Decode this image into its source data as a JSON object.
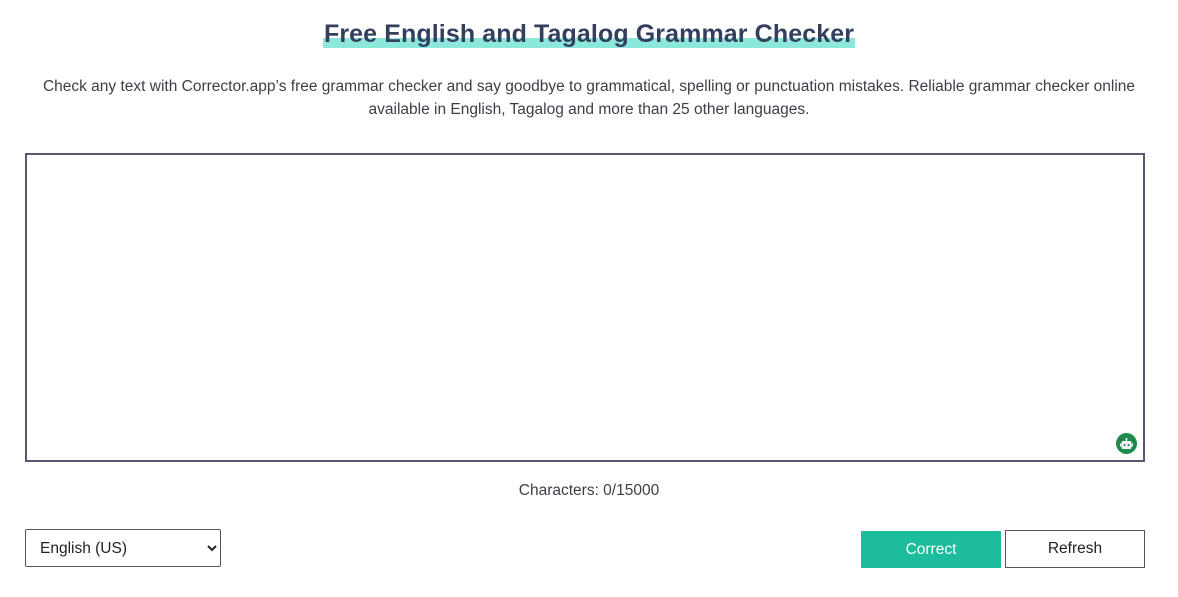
{
  "header": {
    "title": "Free English and Tagalog Grammar Checker",
    "subtitle": "Check any text with Corrector.app’s free grammar checker and say goodbye to grammatical, spelling or punctuation mistakes. Reliable grammar checker online available in English, Tagalog and more than 25 other languages."
  },
  "editor": {
    "value": "",
    "assist_icon": "robot-icon",
    "icon_color": "#1f8a4c"
  },
  "counter": {
    "text": "Characters: 0/15000"
  },
  "controls": {
    "language": {
      "selected": "English (US)",
      "options": [
        "English (US)"
      ]
    },
    "correct_label": "Correct",
    "refresh_label": "Refresh"
  },
  "colors": {
    "accent": "#1dbc9c",
    "title_highlight": "#8de8dc",
    "title_text": "#343f5e"
  }
}
